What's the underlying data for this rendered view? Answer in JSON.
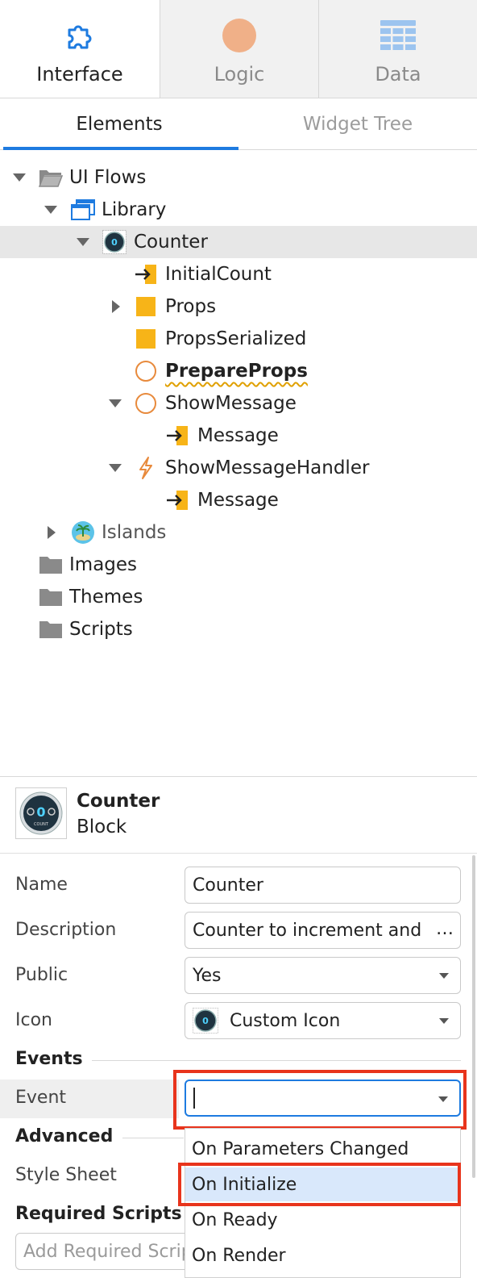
{
  "tabs": [
    {
      "label": "Interface",
      "icon": "puzzle-icon",
      "active": true
    },
    {
      "label": "Logic",
      "icon": "logic-circle-icon",
      "active": false
    },
    {
      "label": "Data",
      "icon": "data-grid-icon",
      "active": false
    }
  ],
  "subtabs": [
    {
      "label": "Elements",
      "active": true
    },
    {
      "label": "Widget Tree",
      "active": false
    }
  ],
  "tree": {
    "ui_flows": "UI Flows",
    "library": "Library",
    "counter": "Counter",
    "initial_count": "InitialCount",
    "props": "Props",
    "props_serialized": "PropsSerialized",
    "prepare_props": "PrepareProps",
    "show_message": "ShowMessage",
    "show_message_param": "Message",
    "show_message_handler": "ShowMessageHandler",
    "handler_param": "Message",
    "islands": "Islands",
    "images": "Images",
    "themes": "Themes",
    "scripts": "Scripts"
  },
  "block": {
    "name": "Counter",
    "type": "Block",
    "avatar_text": "COUNT",
    "avatar_digit": "0"
  },
  "props": {
    "name_label": "Name",
    "name_value": "Counter",
    "description_label": "Description",
    "description_value": "Counter to increment and",
    "description_ellipsis": "…",
    "public_label": "Public",
    "public_value": "Yes",
    "icon_label": "Icon",
    "icon_value": "Custom Icon"
  },
  "events": {
    "section_title": "Events",
    "event_label": "Event",
    "event_value": ""
  },
  "advanced": {
    "section_title": "Advanced",
    "style_sheet_label": "Style Sheet"
  },
  "required_scripts": {
    "section_title": "Required Scripts",
    "placeholder": "Add Required Scripts"
  },
  "event_options": [
    "On Parameters Changed",
    "On Initialize",
    "On Ready",
    "On Render"
  ],
  "colors": {
    "accent": "#1e7be0",
    "highlight": "#e8341c",
    "variable": "#f7b418",
    "logic": "#f0b088"
  }
}
